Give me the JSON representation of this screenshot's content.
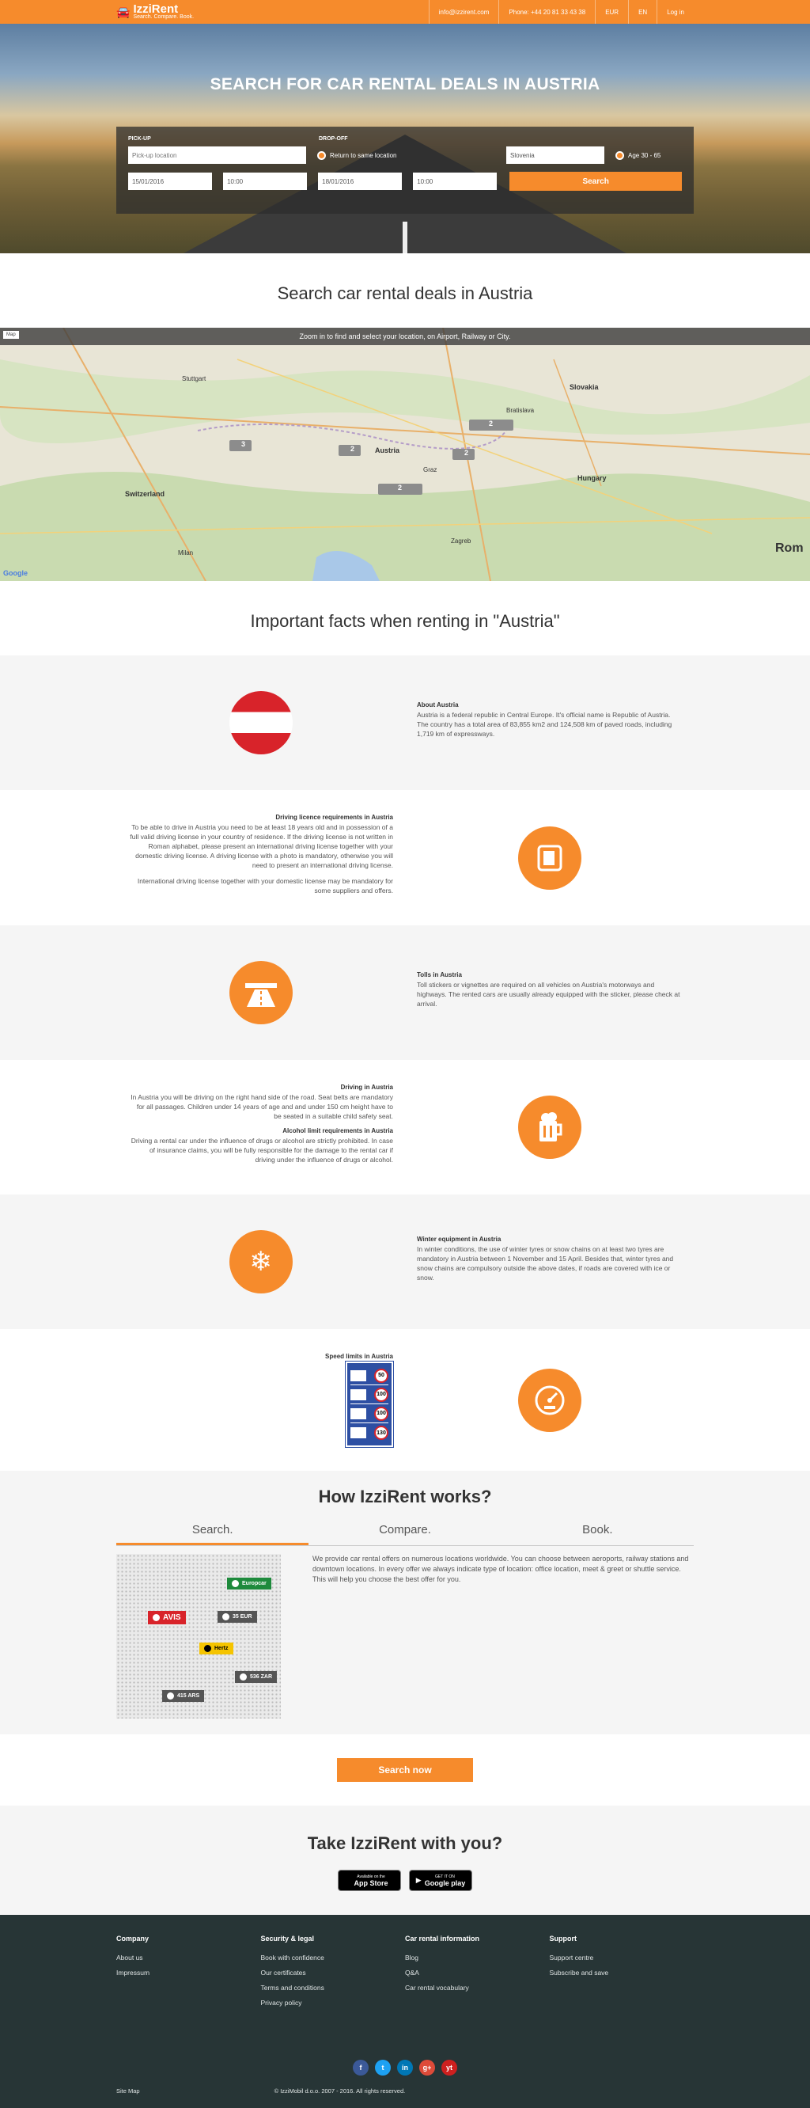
{
  "header": {
    "logo_name": "IzziRent",
    "logo_tagline": "Search. Compare. Book.",
    "email": "info@izzirent.com",
    "phone": "Phone: +44 20 81 33 43 38",
    "currency": "EUR",
    "language": "EN",
    "login": "Log in"
  },
  "hero": {
    "title": "SEARCH FOR CAR RENTAL DEALS IN AUSTRIA",
    "pickup_label": "PICK-UP",
    "dropoff_label": "DROP-OFF",
    "pickup_placeholder": "Pick-up location",
    "return_same": "Return to same location",
    "country": "Slovenia",
    "age": "Age 30 - 65",
    "pickup_date": "15/01/2016",
    "pickup_time": "10:00",
    "dropoff_date": "18/01/2016",
    "dropoff_time": "10:00",
    "search_button": "Search"
  },
  "map_section": {
    "title": "Search car rental deals in Austria",
    "banner": "Zoom in to find and select your location, on Airport, Railway or City.",
    "cities": [
      "Slovakia",
      "Austria",
      "Switzerland",
      "Hungary",
      "Bratislava",
      "Graz",
      "Stuttgart",
      "Zagreb",
      "Milan",
      "Rom"
    ],
    "markers": [
      "3",
      "2",
      "2",
      "2",
      "2"
    ],
    "map_type": "Map",
    "google": "Google"
  },
  "facts": {
    "title": "Important facts when renting in \"Austria\"",
    "about": {
      "heading": "About Austria",
      "text": "Austria is a federal republic in Central Europe. It's official name is Republic of Austria. The country has a total area of 83,855 km2 and 124,508 km of paved roads, including 1,719 km of expressways."
    },
    "licence": {
      "heading": "Driving licence requirements in Austria",
      "text": "To be able to drive in Austria you need to be at least 18 years old and in possession of a full valid driving license in your country of residence. If the driving license is not written in Roman alphabet, please present an international driving license together with your domestic driving license. A driving license with a photo is mandatory, otherwise you will need to present an international driving license.",
      "text2": "International driving license together with your domestic license may be mandatory for some suppliers and offers."
    },
    "tolls": {
      "heading": "Tolls in Austria",
      "text": "Toll stickers or vignettes are required on all vehicles on Austria's motorways and highways. The rented cars are usually already equipped with the sticker, please check at arrival."
    },
    "driving": {
      "heading": "Driving in Austria",
      "text": "In Austria you will be driving on the right hand side of the road. Seat belts are mandatory for all passages. Children under 14 years of age and and under 150 cm height have to be seated in a suitable child safety seat.",
      "heading2": "Alcohol limit requirements in Austria",
      "text2": "Driving a rental car under the influence of drugs or alcohol are strictly prohibited. In case of insurance claims, you will be fully responsible for the damage to the rental car if driving under the influence of drugs or alcohol."
    },
    "winter": {
      "heading": "Winter equipment in Austria",
      "text": "In winter conditions, the use of winter tyres or snow chains on at least two tyres are mandatory in Austria between 1 November and 15 April. Besides that, winter tyres and snow chains are compulsory outside the above dates, if roads are covered with ice or snow."
    },
    "speed": {
      "heading": "Speed limits in Austria",
      "limits": [
        "50",
        "100",
        "100",
        "130"
      ]
    }
  },
  "how": {
    "title": "How IzziRent works?",
    "tabs": [
      "Search.",
      "Compare.",
      "Book."
    ],
    "text": "We provide car rental offers on numerous locations worldwide. You can choose between aeroports, railway stations and downtown locations. In every offer we always indicate type of location: office location, meet & greet or shuttle service. This will help you choose the best offer for you.",
    "badges": [
      "Europcar",
      "AVIS",
      "35 EUR",
      "Hertz",
      "536 ZAR",
      "415 ARS"
    ]
  },
  "cta": {
    "button": "Search now"
  },
  "apps": {
    "title": "Take IzziRent with you?",
    "appstore_small": "Available on the",
    "appstore": "App Store",
    "google_small": "GET IT ON",
    "google": "Google play"
  },
  "footer": {
    "company_title": "Company",
    "company_links": [
      "About us",
      "Impressum"
    ],
    "security_title": "Security & legal",
    "security_links": [
      "Book with confidence",
      "Our certificates",
      "Terms and conditions",
      "Privacy policy"
    ],
    "info_title": "Car rental information",
    "info_links": [
      "Blog",
      "Q&A",
      "Car rental vocabulary"
    ],
    "support_title": "Support",
    "support_links": [
      "Support centre",
      "Subscribe and save"
    ],
    "sitemap": "Site Map",
    "copyright": "© IzziMobil d.o.o. 2007 - 2016. All rights reserved.",
    "social": [
      "f",
      "t",
      "in",
      "g+",
      "yt"
    ]
  },
  "colors": {
    "accent": "#f68b2c",
    "footer": "#273536"
  }
}
